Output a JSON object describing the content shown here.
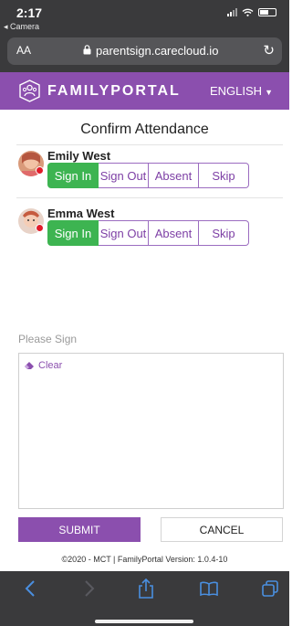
{
  "status_bar": {
    "time": "2:17",
    "back_label": "◂ Camera"
  },
  "browser": {
    "text_size_label": "AA",
    "url": "parentsign.carecloud.io"
  },
  "header": {
    "brand": "FAMILYPORTAL",
    "language": "ENGLISH",
    "brand_color": "#8b4fae"
  },
  "page": {
    "title": "Confirm Attendance"
  },
  "actions_labels": [
    "Sign In",
    "Sign Out",
    "Absent",
    "Skip"
  ],
  "children": [
    {
      "name": "Emily West",
      "selected": "Sign In"
    },
    {
      "name": "Emma West",
      "selected": "Sign In"
    }
  ],
  "signature": {
    "label": "Please Sign",
    "clear_label": "Clear"
  },
  "buttons": {
    "submit": "SUBMIT",
    "cancel": "CANCEL"
  },
  "footer": {
    "text": "©2020  -  MCT | FamilyPortal  Version:  1.0.4-10"
  },
  "colors": {
    "active_green": "#3db451",
    "purple": "#8b4fae",
    "status_dot": "#e11c2a"
  },
  "toolbar_icons": [
    "back-icon",
    "forward-icon",
    "share-icon",
    "bookmarks-icon",
    "tabs-icon"
  ]
}
